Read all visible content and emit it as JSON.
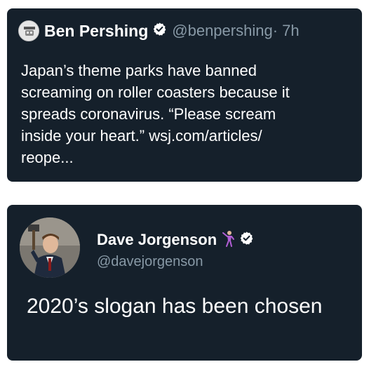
{
  "tweet1": {
    "author_name": "Ben Pershing",
    "handle": "@benpershing",
    "time": " · 7h",
    "text_line1": "Japan’s theme parks have banned",
    "text_line2": "screaming on roller coasters because it",
    "text_line3": "spreads coronavirus. “Please scream",
    "text_line4_prefix": "inside your heart.” ",
    "link_part1": "wsj.com/articles/",
    "link_part2": "reope..."
  },
  "tweet2": {
    "author_name": "Dave Jorgenson",
    "handle": "@davejorgenson",
    "text": "2020’s slogan has been chosen"
  },
  "colors": {
    "card_background": "#15202b",
    "secondary_text": "#8899a6",
    "verified_badge": "#ffffff"
  },
  "icons": {
    "verified": "verified-badge-icon",
    "emoji": "person-dancing-emoji-icon"
  }
}
